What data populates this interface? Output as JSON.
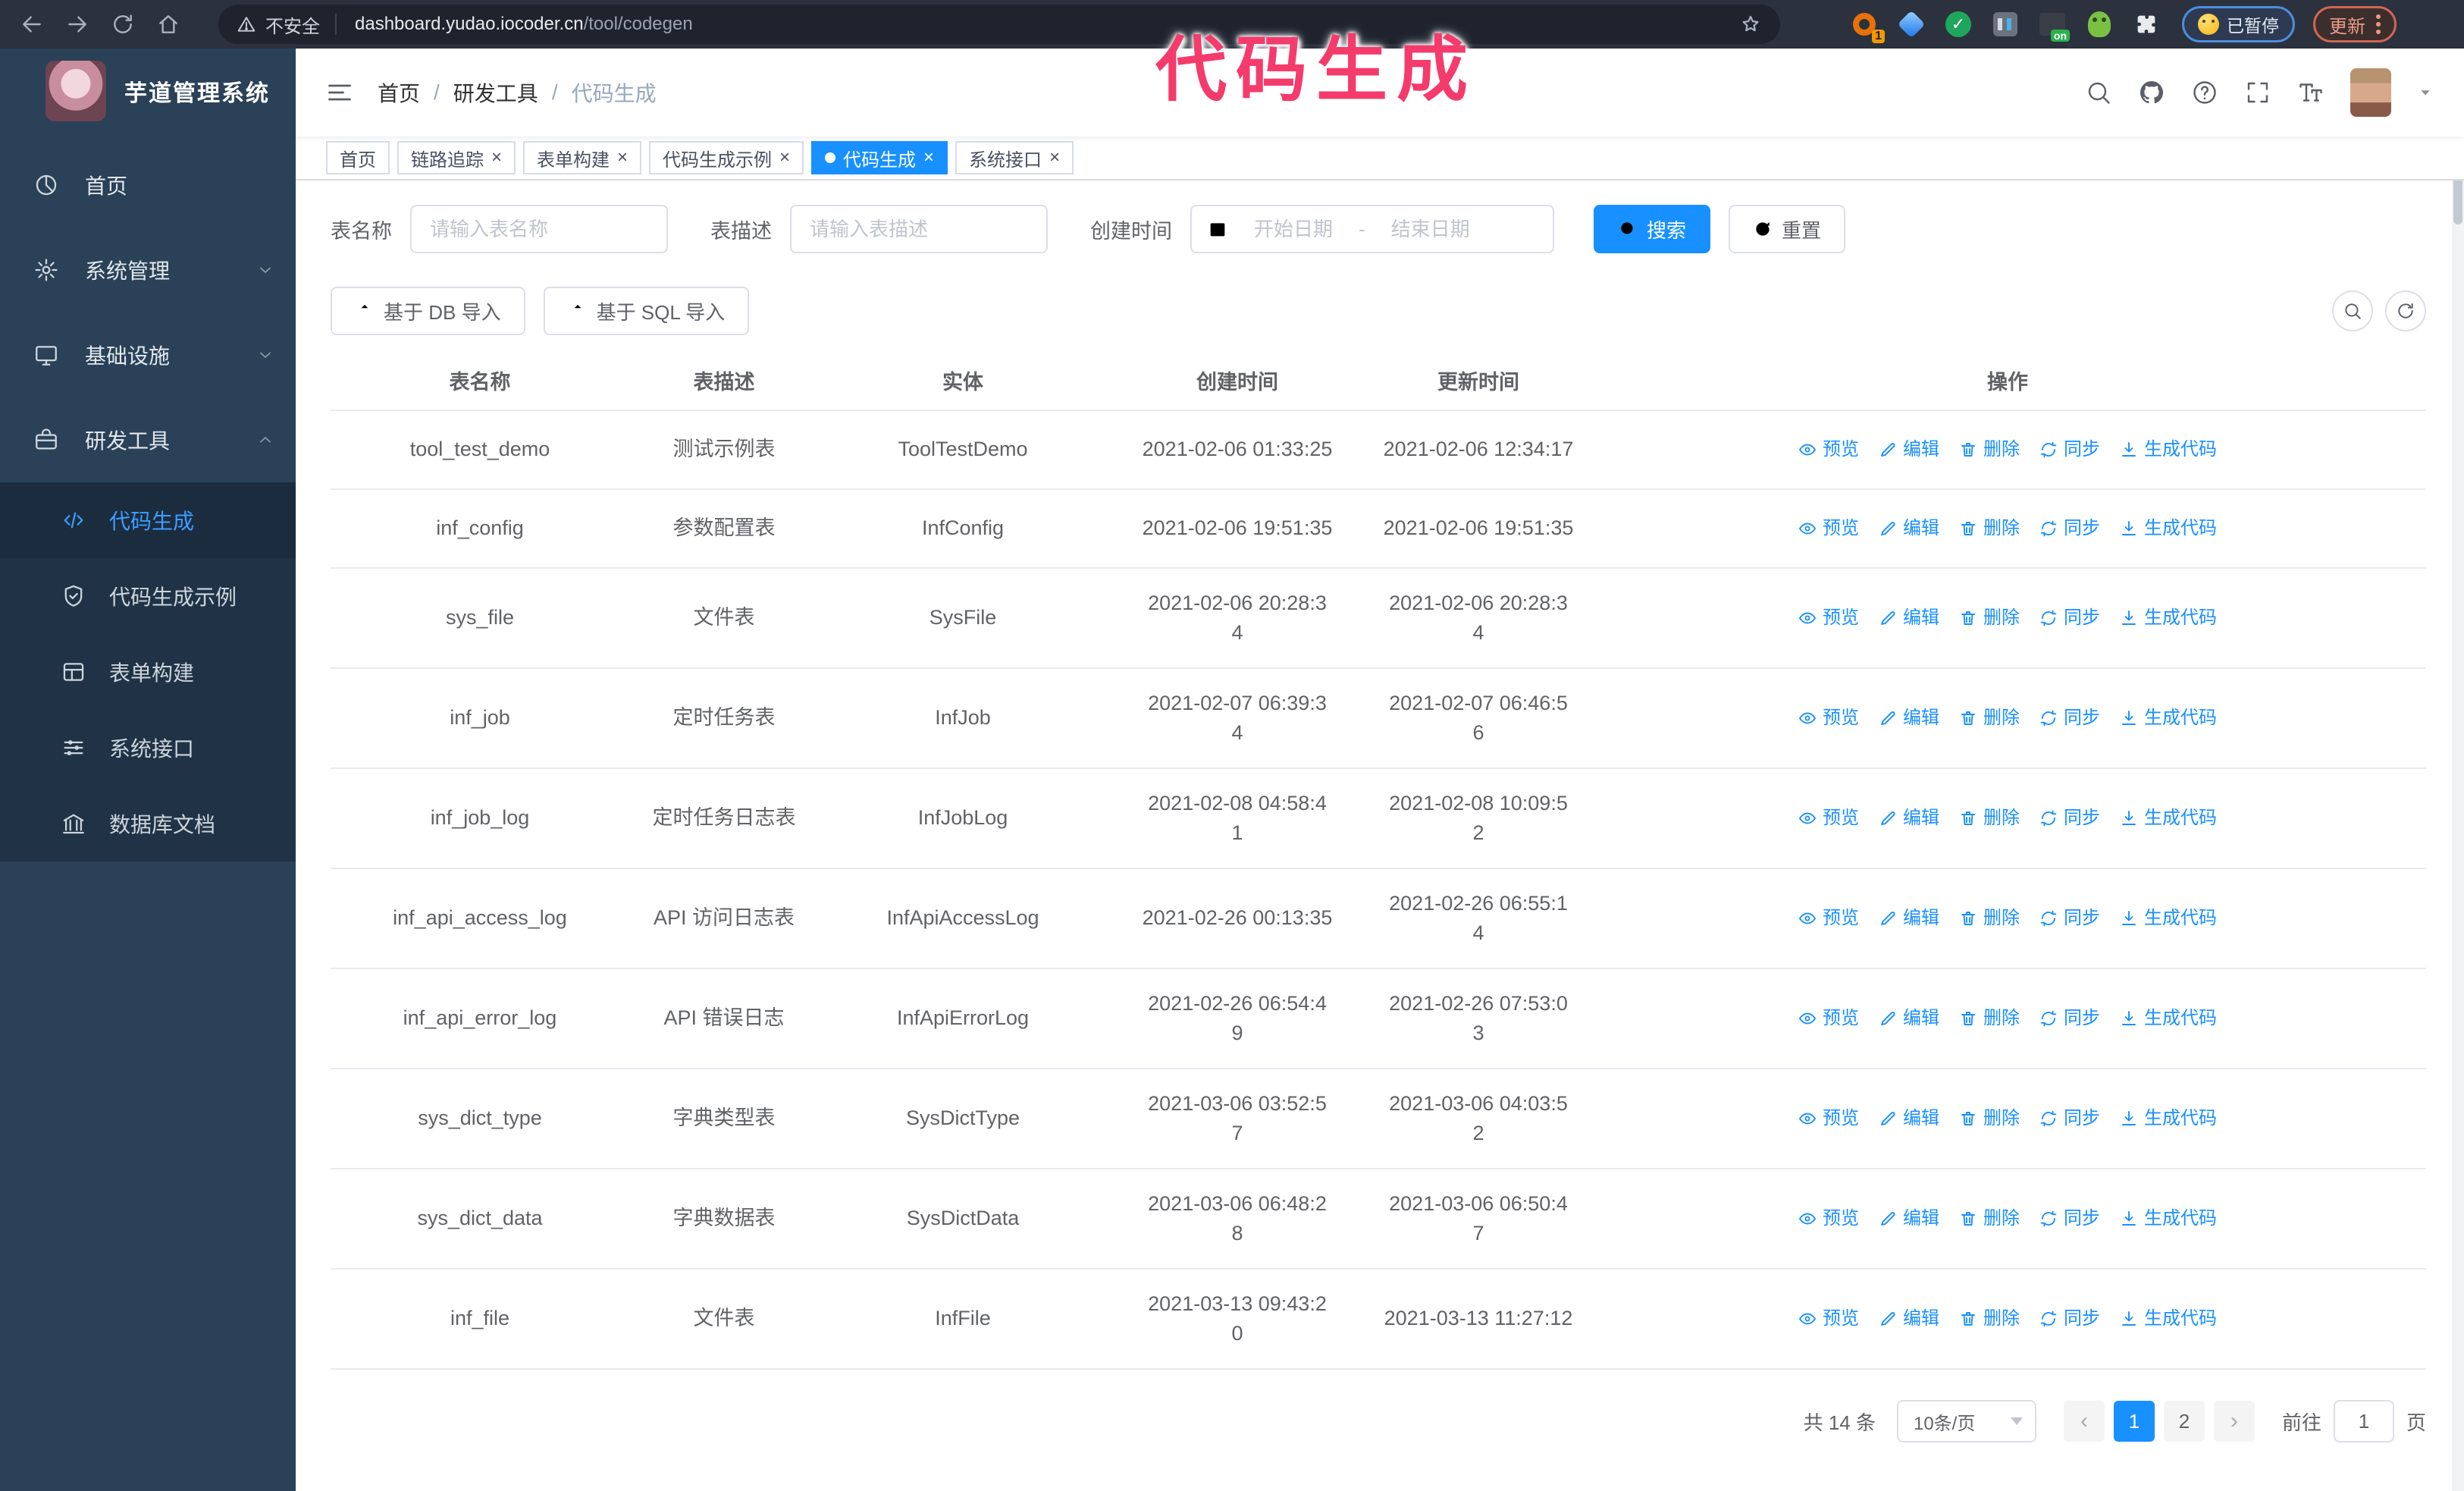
{
  "browser": {
    "security_label": "不安全",
    "url_domain": "dashboard.yudao.iocoder.cn",
    "url_path": "/tool/codegen",
    "extension_badge": "1",
    "paused_label": "已暂停",
    "update_label": "更新"
  },
  "watermark": {
    "text": "代码生成",
    "color": "#f43b6c"
  },
  "sidebar": {
    "title": "芋道管理系统",
    "items": [
      {
        "icon": "dashboard",
        "label": "首页",
        "chevron": null,
        "active": false
      },
      {
        "icon": "gear",
        "label": "系统管理",
        "chevron": "down",
        "active": false
      },
      {
        "icon": "monitor",
        "label": "基础设施",
        "chevron": "down",
        "active": false
      },
      {
        "icon": "toolbox",
        "label": "研发工具",
        "chevron": "up",
        "active": false
      }
    ],
    "submenu": [
      {
        "icon": "code",
        "label": "代码生成",
        "active": true
      },
      {
        "icon": "shield-check",
        "label": "代码生成示例",
        "active": false
      },
      {
        "icon": "form",
        "label": "表单构建",
        "active": false
      },
      {
        "icon": "sliders",
        "label": "系统接口",
        "active": false
      },
      {
        "icon": "database",
        "label": "数据库文档",
        "active": false
      }
    ]
  },
  "breadcrumb": {
    "items": [
      "首页",
      "研发工具",
      "代码生成"
    ],
    "separator": "/"
  },
  "tags": [
    {
      "label": "首页",
      "closable": false,
      "active": false
    },
    {
      "label": "链路追踪",
      "closable": true,
      "active": false
    },
    {
      "label": "表单构建",
      "closable": true,
      "active": false
    },
    {
      "label": "代码生成示例",
      "closable": true,
      "active": false
    },
    {
      "label": "代码生成",
      "closable": true,
      "active": true
    },
    {
      "label": "系统接口",
      "closable": true,
      "active": false
    }
  ],
  "search_form": {
    "name_label": "表名称",
    "name_placeholder": "请输入表名称",
    "desc_label": "表描述",
    "desc_placeholder": "请输入表描述",
    "time_label": "创建时间",
    "start_placeholder": "开始日期",
    "range_separator": "-",
    "end_placeholder": "结束日期",
    "search_button": "搜索",
    "reset_button": "重置"
  },
  "import_bar": {
    "db_button": "基于 DB 导入",
    "sql_button": "基于 SQL 导入"
  },
  "table": {
    "headers": [
      "表名称",
      "表描述",
      "实体",
      "创建时间",
      "更新时间",
      "操作"
    ],
    "actions": [
      "预览",
      "编辑",
      "删除",
      "同步",
      "生成代码"
    ],
    "rows": [
      {
        "name": "tool_test_demo",
        "desc": "测试示例表",
        "entity": "ToolTestDemo",
        "created": "2021-02-06 01:33:25",
        "updated": "2021-02-06 12:34:17"
      },
      {
        "name": "inf_config",
        "desc": "参数配置表",
        "entity": "InfConfig",
        "created": "2021-02-06 19:51:35",
        "updated": "2021-02-06 19:51:35"
      },
      {
        "name": "sys_file",
        "desc": "文件表",
        "entity": "SysFile",
        "created": "2021-02-06 20:28:3\n4",
        "updated": "2021-02-06 20:28:3\n4"
      },
      {
        "name": "inf_job",
        "desc": "定时任务表",
        "entity": "InfJob",
        "created": "2021-02-07 06:39:3\n4",
        "updated": "2021-02-07 06:46:5\n6"
      },
      {
        "name": "inf_job_log",
        "desc": "定时任务日志表",
        "entity": "InfJobLog",
        "created": "2021-02-08 04:58:4\n1",
        "updated": "2021-02-08 10:09:5\n2"
      },
      {
        "name": "inf_api_access_log",
        "desc": "API 访问日志表",
        "entity": "InfApiAccessLog",
        "created": "2021-02-26 00:13:35",
        "updated": "2021-02-26 06:55:1\n4"
      },
      {
        "name": "inf_api_error_log",
        "desc": "API 错误日志",
        "entity": "InfApiErrorLog",
        "created": "2021-02-26 06:54:4\n9",
        "updated": "2021-02-26 07:53:0\n3"
      },
      {
        "name": "sys_dict_type",
        "desc": "字典类型表",
        "entity": "SysDictType",
        "created": "2021-03-06 03:52:5\n7",
        "updated": "2021-03-06 04:03:5\n2"
      },
      {
        "name": "sys_dict_data",
        "desc": "字典数据表",
        "entity": "SysDictData",
        "created": "2021-03-06 06:48:2\n8",
        "updated": "2021-03-06 06:50:4\n7"
      },
      {
        "name": "inf_file",
        "desc": "文件表",
        "entity": "InfFile",
        "created": "2021-03-13 09:43:2\n0",
        "updated": "2021-03-13 11:27:12"
      }
    ]
  },
  "pagination": {
    "total": "共 14 条",
    "page_size": "10条/页",
    "pages": [
      "1",
      "2"
    ],
    "active_page": "1",
    "goto_label": "前往",
    "goto_value": "1",
    "unit_label": "页"
  },
  "colors": {
    "accent": "#1890ff",
    "sidebar_bg": "#2a4157",
    "submenu_bg": "#203346",
    "active_link": "#3d9dff",
    "watermark": "#f43b6c"
  }
}
